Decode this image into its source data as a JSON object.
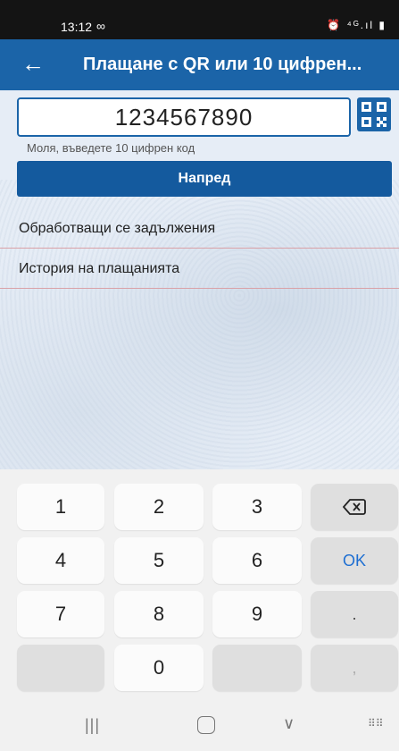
{
  "status_bar": {
    "time": "13:12",
    "infinity": "∞",
    "icons": "⏰ ⁴ᴳ.ıl ▮"
  },
  "app_bar": {
    "back": "←",
    "title": "Плащане с QR или  10 цифрен..."
  },
  "form": {
    "code_value": "1234567890",
    "hint": "Моля, въведете 10 цифрен код",
    "next_label": "Напред"
  },
  "menu": {
    "items": [
      {
        "label": "Обработващи се задължения"
      },
      {
        "label": "История на плащанията"
      }
    ]
  },
  "keypad": {
    "keys": [
      "1",
      "2",
      "3",
      "⌫",
      "4",
      "5",
      "6",
      "OK",
      "7",
      "8",
      "9",
      ".",
      "",
      "0",
      "",
      ","
    ]
  },
  "nav_bar": {
    "recent": "|||",
    "back": "∨",
    "keyboard": "⠿⠿"
  },
  "colors": {
    "accent": "#1b64a8",
    "button": "#145a9e",
    "divider": "#d9a1a7",
    "ok": "#1e6fd2"
  }
}
